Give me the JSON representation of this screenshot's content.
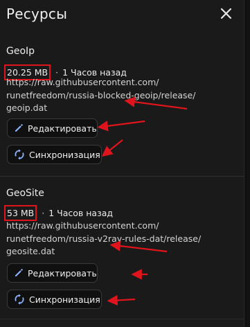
{
  "header": {
    "title": "Ресурсы",
    "close_icon": "close-icon"
  },
  "resources": [
    {
      "name": "GeoIp",
      "size": "20.25 MB",
      "separator": "·",
      "updated": "1 Часов назад",
      "url_lines": [
        "https://raw.githubusercontent.com/",
        "runetfreedom/russia-blocked-geoip/release/",
        "geoip.dat"
      ],
      "edit_label": "Редактировать",
      "sync_label": "Синхронизация"
    },
    {
      "name": "GeoSite",
      "size": "53 MB",
      "separator": "·",
      "updated": "1 Часов назад",
      "url_lines": [
        "https://raw.githubusercontent.com/",
        "runetfreedom/russia-v2ray-rules-dat/release/",
        "geosite.dat"
      ],
      "edit_label": "Редактировать",
      "sync_label": "Синхронизация"
    }
  ],
  "colors": {
    "background": "#1a1a1a",
    "highlight": "#e0141c",
    "arrow": "#e0141c",
    "text": "#ececec"
  },
  "icons": {
    "edit": "pencil-icon",
    "sync": "sync-icon"
  }
}
